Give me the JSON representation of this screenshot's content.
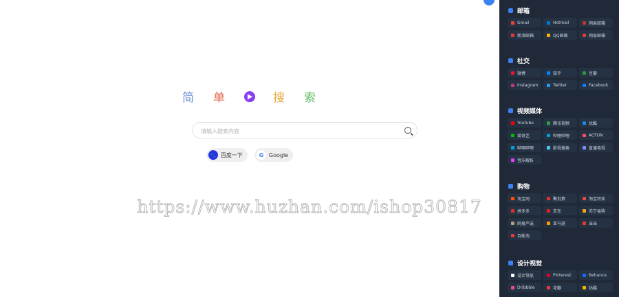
{
  "brand": {
    "chars": [
      "简",
      "单",
      "搜",
      "索"
    ]
  },
  "search": {
    "placeholder": "请输入搜索内容",
    "value": ""
  },
  "engines": [
    {
      "label": "百度一下",
      "icon": "baidu-paw-icon"
    },
    {
      "label": "Google",
      "icon": "google-g-icon"
    }
  ],
  "watermark": "https://www.huzhan.com/ishop30817",
  "sidebar": {
    "sections": [
      {
        "title": "邮箱",
        "icon": "mail-icon",
        "items": [
          {
            "label": "Gmail",
            "color": "#ea4335"
          },
          {
            "label": "Hotmail",
            "color": "#0078d4"
          },
          {
            "label": "网易邮箱",
            "color": "#c0392b"
          },
          {
            "label": "新浪邮箱",
            "color": "#e53935"
          },
          {
            "label": "QQ邮箱",
            "color": "#f4b400"
          },
          {
            "label": "网易邮箱",
            "color": "#e53935"
          }
        ]
      },
      {
        "title": "社交",
        "icon": "chat-icon",
        "items": [
          {
            "label": "微博",
            "color": "#e6162d"
          },
          {
            "label": "知乎",
            "color": "#0084ff"
          },
          {
            "label": "豆瓣",
            "color": "#2e963d"
          },
          {
            "label": "Instagram",
            "color": "#c13584"
          },
          {
            "label": "Twitter",
            "color": "#1da1f2"
          },
          {
            "label": "Facebook",
            "color": "#1877f2"
          }
        ]
      },
      {
        "title": "视频媒体",
        "icon": "video-icon",
        "items": [
          {
            "label": "Youtube",
            "color": "#ff0000"
          },
          {
            "label": "腾讯视频",
            "color": "#2ba245"
          },
          {
            "label": "优酷",
            "color": "#1e88e5"
          },
          {
            "label": "爱奇艺",
            "color": "#00be06"
          },
          {
            "label": "哔哩哔哩",
            "color": "#00a1d6"
          },
          {
            "label": "ACFUN",
            "color": "#fd4c5d"
          },
          {
            "label": "哔哩哔哩",
            "color": "#00a1d6"
          },
          {
            "label": "影视搜索",
            "color": "#4fc3f7"
          },
          {
            "label": "直播电视",
            "color": "#7e8cf5"
          },
          {
            "label": "音乐解析",
            "color": "#e040fb"
          }
        ]
      },
      {
        "title": "购物",
        "icon": "cart-icon",
        "items": [
          {
            "label": "淘宝网",
            "color": "#ff5000"
          },
          {
            "label": "聚划算",
            "color": "#e62e2e"
          },
          {
            "label": "淘宝特卖",
            "color": "#e74c3c"
          },
          {
            "label": "拼多多",
            "color": "#e02e24"
          },
          {
            "label": "京东",
            "color": "#e1251b"
          },
          {
            "label": "苏宁易购",
            "color": "#f5a623"
          },
          {
            "label": "网易严选",
            "color": "#b4a078"
          },
          {
            "label": "亚马逊",
            "color": "#ff9900"
          },
          {
            "label": "当当",
            "color": "#e53935"
          },
          {
            "label": "百能淘",
            "color": "#e53935"
          }
        ]
      },
      {
        "title": "设计视觉",
        "icon": "design-icon",
        "items": [
          {
            "label": "设计导航",
            "color": "#ffffff"
          },
          {
            "label": "Pinterest",
            "color": "#e60023"
          },
          {
            "label": "Behance",
            "color": "#1769ff"
          },
          {
            "label": "Dribbble",
            "color": "#ea4c89"
          },
          {
            "label": "花瓣",
            "color": "#e53935"
          },
          {
            "label": "站酷",
            "color": "#f7b500"
          }
        ]
      }
    ]
  }
}
